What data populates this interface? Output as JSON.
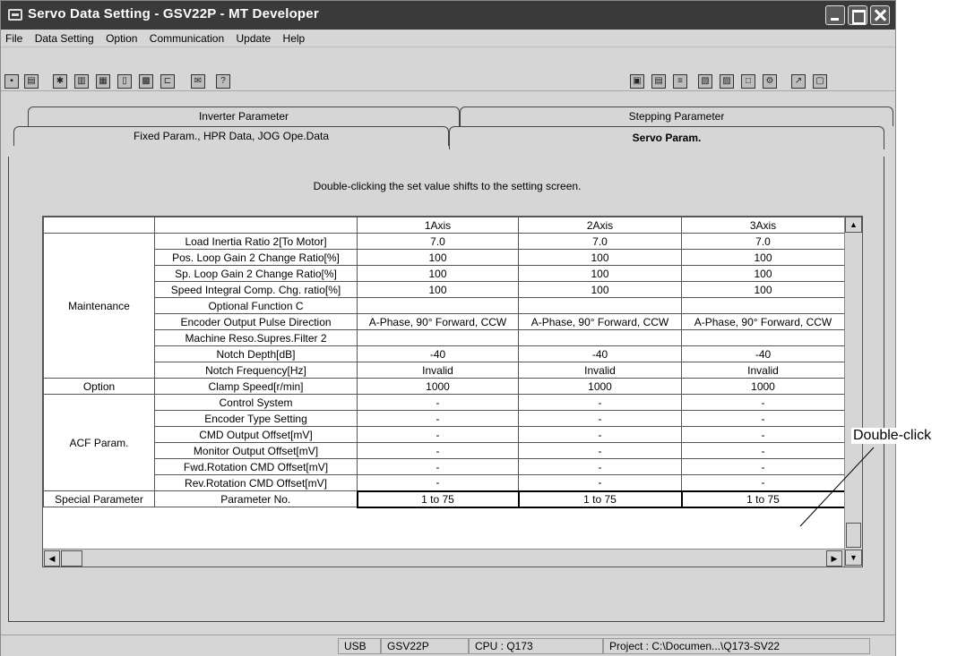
{
  "window": {
    "title": "Servo Data Setting - GSV22P - MT Developer"
  },
  "menu": [
    "File",
    "Data Setting",
    "Option",
    "Communication",
    "Update",
    "Help"
  ],
  "toolbar": {
    "left_icons": [
      "save-icon",
      "print-icon",
      "tool-icon",
      "document-icon",
      "list-icon",
      "page-icon",
      "table-icon",
      "connector-icon",
      "mail-icon",
      "help-icon"
    ],
    "right_icons": [
      "monitor-icon",
      "grid-icon",
      "tree-icon",
      "image-icon",
      "device-icon",
      "window-icon",
      "tool2-icon",
      "arrow-icon",
      "screen-icon"
    ],
    "help_glyph": "?"
  },
  "tabs": {
    "row1": [
      "Inverter Parameter",
      "Stepping Parameter"
    ],
    "row2": [
      "Fixed Param., HPR Data, JOG Ope.Data",
      "Servo Param."
    ]
  },
  "hint": "Double-clicking the set value shifts to the setting screen.",
  "grid": {
    "axes": [
      "1Axis",
      "2Axis",
      "3Axis"
    ],
    "groups": [
      {
        "name": "Maintenance",
        "rows": [
          {
            "label": "Load Inertia Ratio 2[To Motor]",
            "values": [
              "7.0",
              "7.0",
              "7.0"
            ]
          },
          {
            "label": "Pos. Loop Gain 2 Change Ratio[%]",
            "values": [
              "100",
              "100",
              "100"
            ]
          },
          {
            "label": "Sp. Loop Gain 2 Change Ratio[%]",
            "values": [
              "100",
              "100",
              "100"
            ]
          },
          {
            "label": "Speed Integral Comp. Chg. ratio[%]",
            "values": [
              "100",
              "100",
              "100"
            ]
          },
          {
            "label": "Optional Function C",
            "values": [
              "",
              "",
              ""
            ]
          },
          {
            "label": "Encoder Output Pulse Direction",
            "values": [
              "A-Phase, 90° Forward, CCW",
              "A-Phase, 90° Forward, CCW",
              "A-Phase, 90° Forward, CCW"
            ]
          },
          {
            "label": "Machine Reso.Supres.Filter 2",
            "values": [
              "",
              "",
              ""
            ]
          },
          {
            "label": "Notch Depth[dB]",
            "values": [
              "-40",
              "-40",
              "-40"
            ]
          },
          {
            "label": "Notch Frequency[Hz]",
            "values": [
              "Invalid",
              "Invalid",
              "Invalid"
            ]
          }
        ]
      },
      {
        "name": "Option",
        "rows": [
          {
            "label": "Clamp Speed[r/min]",
            "values": [
              "1000",
              "1000",
              "1000"
            ]
          }
        ]
      },
      {
        "name": "ACF Param.",
        "rows": [
          {
            "label": "Control System",
            "values": [
              "-",
              "-",
              "-"
            ]
          },
          {
            "label": "Encoder Type Setting",
            "values": [
              "-",
              "-",
              "-"
            ]
          },
          {
            "label": "CMD Output Offset[mV]",
            "values": [
              "-",
              "-",
              "-"
            ]
          },
          {
            "label": "Monitor Output Offset[mV]",
            "values": [
              "-",
              "-",
              "-"
            ]
          },
          {
            "label": "Fwd.Rotation CMD Offset[mV]",
            "values": [
              "-",
              "-",
              "-"
            ]
          },
          {
            "label": "Rev.Rotation CMD Offset[mV]",
            "values": [
              "-",
              "-",
              "-"
            ]
          }
        ]
      },
      {
        "name": "Special Parameter",
        "rows": [
          {
            "label": "Parameter No.",
            "values": [
              "1 to 75",
              "1 to 75",
              "1 to 75"
            ]
          }
        ]
      }
    ]
  },
  "status": {
    "connection": "USB",
    "model": "GSV22P",
    "cpu": "CPU : Q173",
    "project": "Project : C:\\Documen...\\Q173-SV22"
  },
  "annotation": "Double-click"
}
